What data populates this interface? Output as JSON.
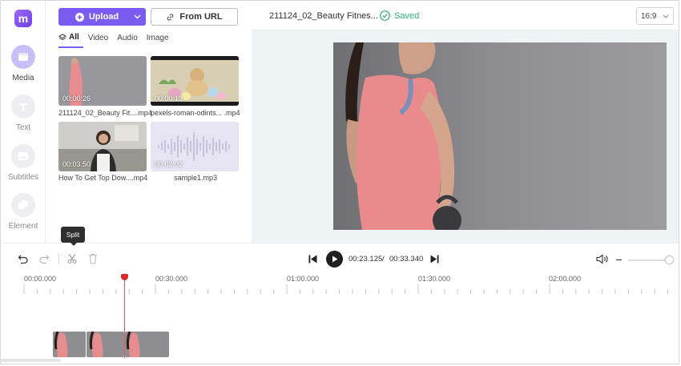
{
  "nav": {
    "items": [
      {
        "label": "Media",
        "icon": "media-icon",
        "active": true
      },
      {
        "label": "Text",
        "icon": "text-icon",
        "active": false
      },
      {
        "label": "Subtitles",
        "icon": "subtitles-icon",
        "active": false
      },
      {
        "label": "Element",
        "icon": "element-icon",
        "active": false
      }
    ]
  },
  "panel": {
    "upload_label": "Upload",
    "url_label": "From URL",
    "tabs": [
      "All",
      "Video",
      "Audio",
      "Image"
    ],
    "media": [
      {
        "name": "211124_02_Beauty Fit....mp4",
        "duration": "00:00:26"
      },
      {
        "name": "pexels-roman-odints... .mp4",
        "duration": "00:00:13"
      },
      {
        "name": "How To Get Top Dow....mp4",
        "duration": "00:03:50"
      },
      {
        "name": "sample1.mp3",
        "duration": "00:02:02"
      }
    ]
  },
  "topbar": {
    "project_title": "211124_02_Beauty Fitnes...",
    "saved_label": "Saved",
    "ratio": "16:9"
  },
  "controls": {
    "tooltip": "Split",
    "current_time": "00:23.125",
    "separator": "/",
    "total_time": "00:33.340"
  },
  "timeline": {
    "ticks": [
      "00:00.000",
      "00:30.000",
      "01:00.000",
      "01:30.000",
      "02:00.000"
    ]
  },
  "colors": {
    "accent": "#7b5cf0",
    "saved": "#2db37a",
    "playhead": "#d92b2b"
  }
}
